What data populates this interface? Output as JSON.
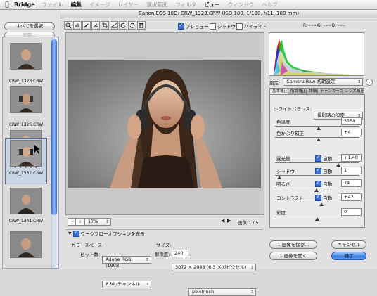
{
  "menubar": {
    "app_name": "Bridge",
    "items": [
      "ファイル",
      "編集",
      "イメージ",
      "レイヤー",
      "選択範囲",
      "フィルタ",
      "ビュー",
      "ウィンドウ",
      "ヘルプ"
    ],
    "active": [
      "編集",
      "ビュー"
    ]
  },
  "left_panel": {
    "select_all_label": "すべてを選択",
    "sync_label": "同期...",
    "thumbnails": [
      {
        "name": "",
        "selected": false
      },
      {
        "name": "CRW_1323.CRW",
        "selected": false
      },
      {
        "name": "CRW_1326.CRW",
        "selected": false
      },
      {
        "name": "CRW_1332.CRW",
        "selected": true
      },
      {
        "name": "CRW_1341.CRW",
        "selected": false
      },
      {
        "name": "",
        "selected": false
      }
    ],
    "rating_dots": "• • • • •"
  },
  "dialog": {
    "title": "Canon EOS 10D:  CRW_1323.CRW  (ISO 100, 1/180, f/11, 100 mm)",
    "preview_label": "プレビュー",
    "shadow_label": "シャドウ",
    "highlight_label": "ハイライト",
    "rgb_readout": "R: - - -   G: - - -   B: - - -",
    "zoom_value": "17%",
    "image_counter": "画像 1 / 5"
  },
  "settings": {
    "label": "設定:",
    "value": "Camera Raw 初期設定"
  },
  "tabs": [
    "基本補正",
    "階調補正",
    "詳細",
    "トーンカーブ",
    "レンズ補正"
  ],
  "basic": {
    "white_balance_label": "ホワイトバランス:",
    "white_balance_value": "撮影時の設定",
    "params": [
      {
        "label": "色温度",
        "value": "5250",
        "auto": null,
        "level": 0.52
      },
      {
        "label": "色かぶり補正",
        "value": "+4",
        "auto": null,
        "level": 0.52
      },
      {
        "label": "露光量",
        "value": "+1.40",
        "auto": "自動",
        "level": 0.75
      },
      {
        "label": "シャドウ",
        "value": "1",
        "auto": "自動",
        "level": 0.05
      },
      {
        "label": "明るさ",
        "value": "74",
        "auto": "自動",
        "level": 0.49
      },
      {
        "label": "コントラスト",
        "value": "+42",
        "auto": "自動",
        "level": 0.55
      },
      {
        "label": "彩度",
        "value": "0",
        "auto": null,
        "level": 0.5
      }
    ]
  },
  "workflow": {
    "toggle_label": "ワークフローオプションを表示",
    "colorspace_label": "カラースペース:",
    "colorspace_value": "Adobe RGB (1998)",
    "size_label": "サイズ:",
    "size_value": "3072 × 2048 (6.3 メガピクセル)",
    "depth_label": "ビット数:",
    "depth_value": "8 bit/チャンネル",
    "resolution_label": "解像度:",
    "resolution_value": "240",
    "resolution_unit": "pixel/inch"
  },
  "actions": {
    "save_label": "1 画像を保存...",
    "cancel_label": "キャンセル",
    "open_label": "1 画像を開く",
    "done_label": "終了"
  },
  "colors": {
    "accent": "#3779e0",
    "scroll": "#3d6fd0"
  }
}
